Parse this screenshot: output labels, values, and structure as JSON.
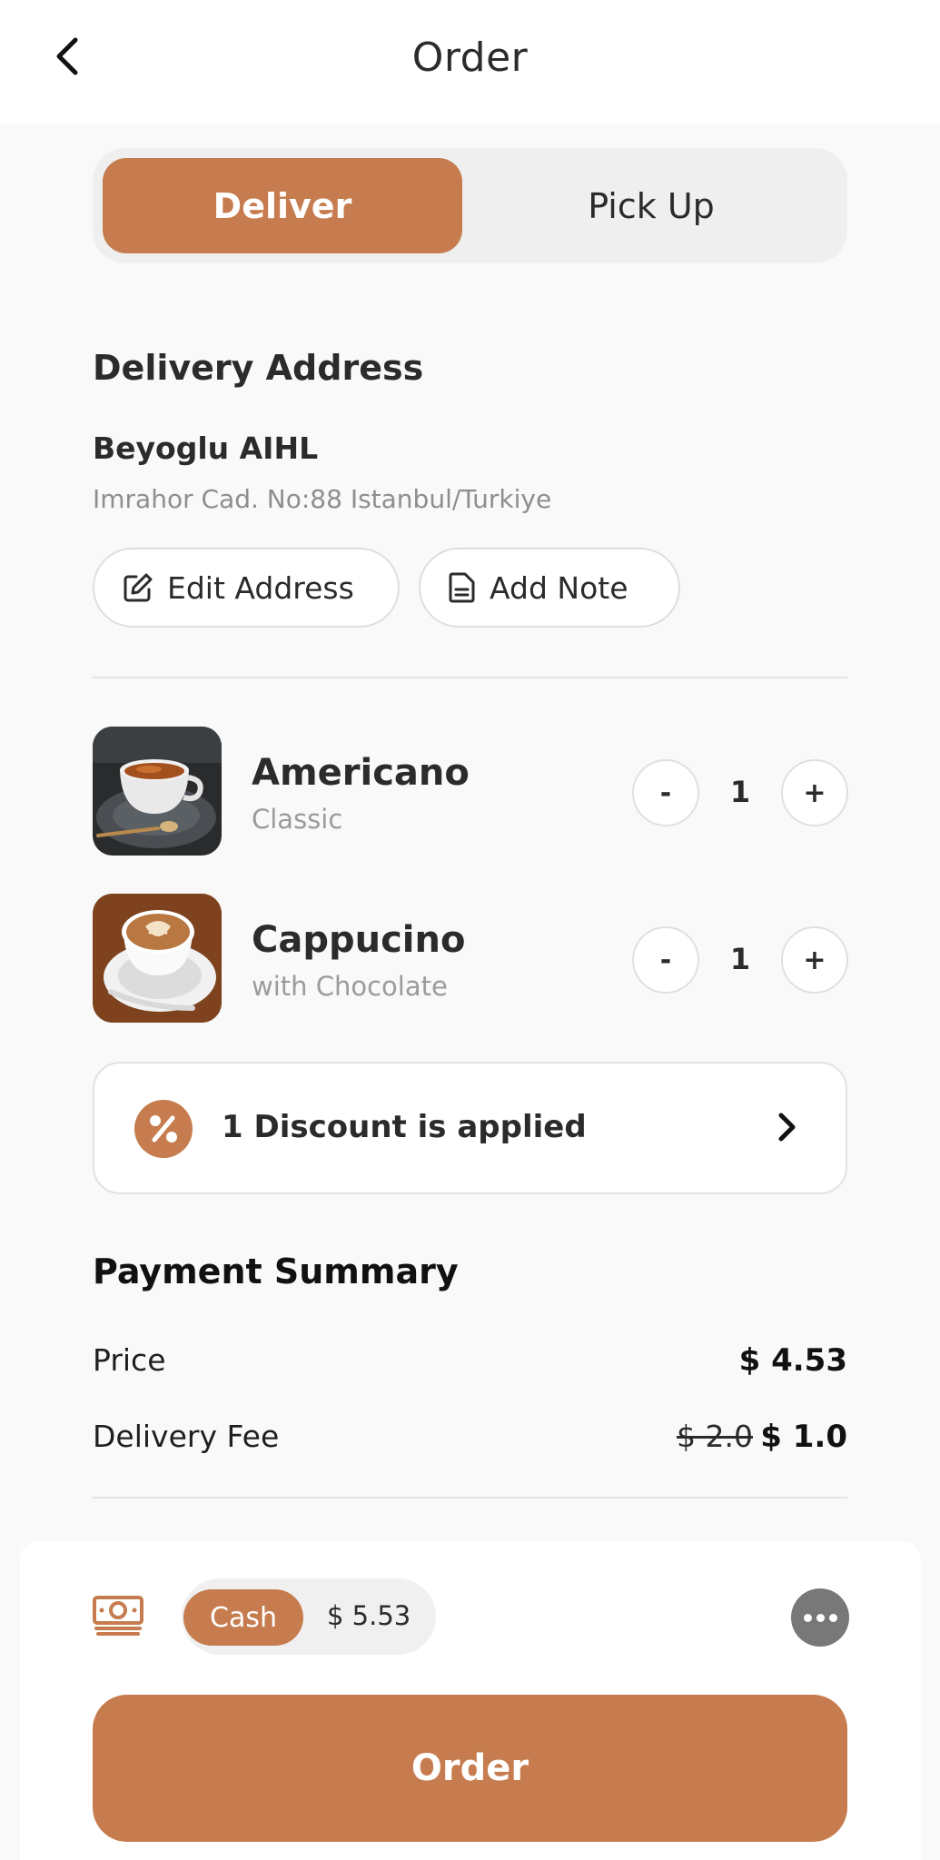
{
  "header": {
    "title": "Order",
    "back_icon": "chevron-left-icon"
  },
  "mode_toggle": {
    "options": [
      "Deliver",
      "Pick Up"
    ],
    "selected": "Deliver"
  },
  "address": {
    "section_title": "Delivery Address",
    "name": "Beyoglu AIHL",
    "line": "Imrahor Cad. No:88 Istanbul/Turkiye",
    "edit_label": "Edit Address",
    "note_label": "Add Note"
  },
  "items": [
    {
      "name": "Americano",
      "variant": "Classic",
      "quantity": "1",
      "minus": "-",
      "plus": "+"
    },
    {
      "name": "Cappucino",
      "variant": "with Chocolate",
      "quantity": "1",
      "minus": "-",
      "plus": "+"
    }
  ],
  "discount": {
    "label": "1 Discount is applied",
    "icon": "percent-icon"
  },
  "payment_summary": {
    "title": "Payment Summary",
    "price_label": "Price",
    "price_value": "$ 4.53",
    "fee_label": "Delivery Fee",
    "fee_original": "$ 2.0",
    "fee_value": "$ 1.0"
  },
  "checkout": {
    "method": "Cash",
    "total": "$ 5.53",
    "order_label": "Order"
  },
  "colors": {
    "accent": "#c67c4e",
    "background": "#f9f9f9",
    "text": "#2b2b2b"
  }
}
